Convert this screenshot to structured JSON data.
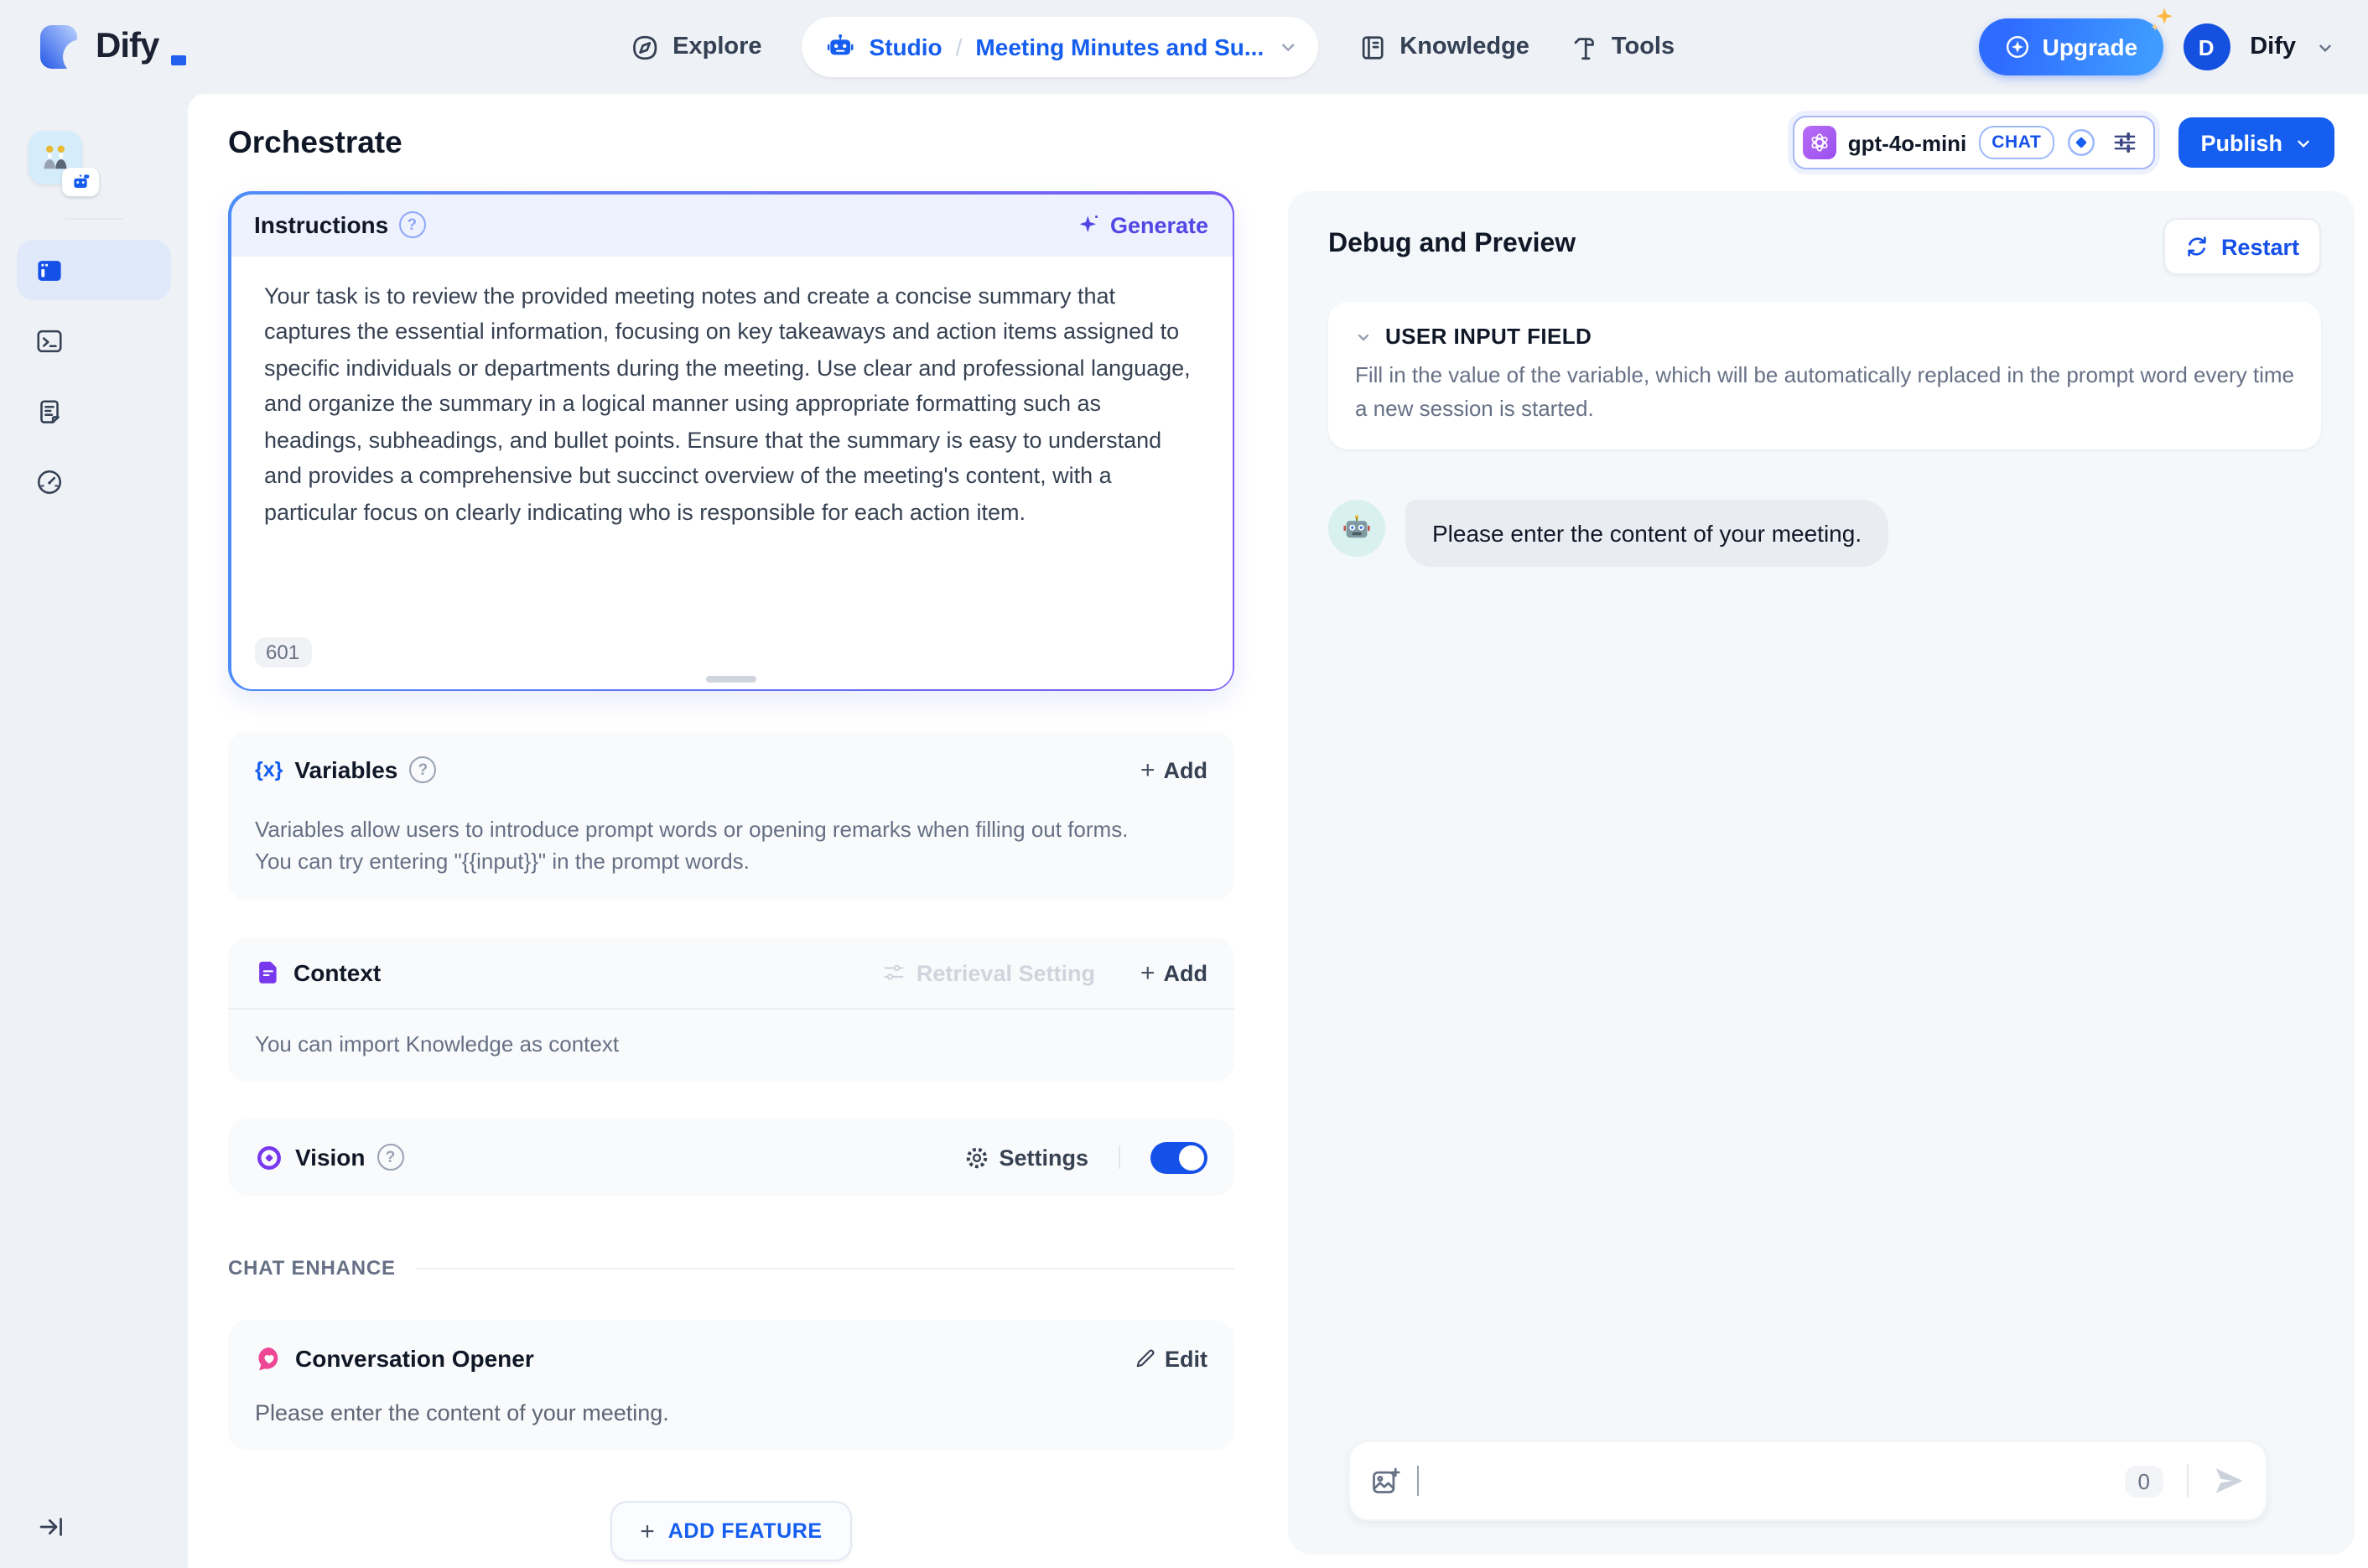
{
  "colors": {
    "accent_blue": "#155eef",
    "indigo": "#5247e5",
    "purple": "#7839ee",
    "pink": "#ed4796",
    "toggle_on": "#1551e8",
    "page_bg": "#eef1f5"
  },
  "header": {
    "logo_text": "Dify",
    "explore_label": "Explore",
    "studio_label": "Studio",
    "breadcrumb_separator": "/",
    "app_name": "Meeting Minutes and Su...",
    "knowledge_label": "Knowledge",
    "tools_label": "Tools",
    "upgrade_label": "Upgrade",
    "account_initial": "D",
    "account_name": "Dify"
  },
  "topbar": {
    "title": "Orchestrate",
    "model_name": "gpt-4o-mini",
    "model_mode_badge": "CHAT",
    "publish_label": "Publish"
  },
  "instructions": {
    "title": "Instructions",
    "generate_label": "Generate",
    "prompt": "Your task is to review the provided meeting notes and create a concise summary that captures the essential information, focusing on key takeaways and action items assigned to specific individuals or departments during the meeting. Use clear and professional language, and organize the summary in a logical manner using appropriate formatting such as headings, subheadings, and bullet points. Ensure that the summary is easy to understand and provides a comprehensive but succinct overview of the meeting's content, with a particular focus on clearly indicating who is responsible for each action item.",
    "char_count": "601"
  },
  "variables": {
    "title": "Variables",
    "add_label": "Add",
    "description": "Variables allow users to introduce prompt words or opening remarks when filling out forms. You can try entering \"{{input}}\" in the prompt words."
  },
  "context": {
    "title": "Context",
    "retrieval_setting_label": "Retrieval Setting",
    "add_label": "Add",
    "empty_hint": "You can import Knowledge as context"
  },
  "vision": {
    "title": "Vision",
    "settings_label": "Settings"
  },
  "chat_enhance": {
    "section_label": "CHAT ENHANCE",
    "opener_title": "Conversation Opener",
    "edit_label": "Edit",
    "opener_message": "Please enter the content of your meeting."
  },
  "add_feature_label": "ADD FEATURE",
  "debug": {
    "title": "Debug and Preview",
    "restart_label": "Restart",
    "user_input_field_title": "USER INPUT FIELD",
    "user_input_field_description": "Fill in the value of the variable, which will be automatically replaced in the prompt word every time a new session is started.",
    "bot_message": "Please enter the content of your meeting.",
    "input_char_count": "0"
  }
}
